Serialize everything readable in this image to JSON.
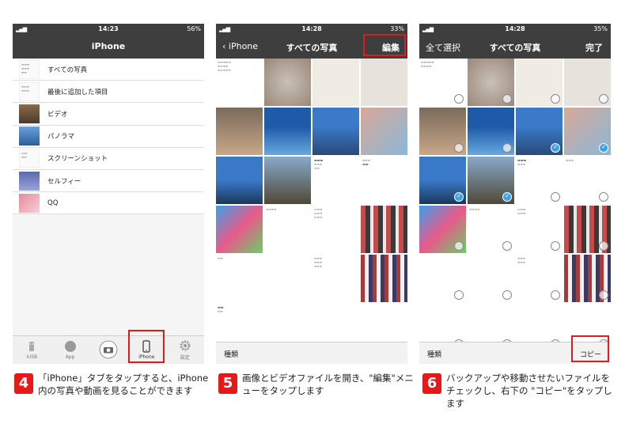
{
  "panel1": {
    "status": {
      "time": "14:23",
      "battery": "56%"
    },
    "title": "iPhone",
    "rows": [
      "すべての写真",
      "最後に追加した項目",
      "ビデオ",
      "パノラマ",
      "スクリーンショット",
      "セルフィー",
      "QQ"
    ],
    "tabs": [
      {
        "label": "iUSB",
        "icon": "usb-icon"
      },
      {
        "label": "App",
        "icon": "app-icon"
      },
      {
        "label": "",
        "icon": "camera-icon"
      },
      {
        "label": "iPhone",
        "icon": "iphone-icon"
      },
      {
        "label": "設定",
        "icon": "gear-icon"
      }
    ]
  },
  "panel2": {
    "status": {
      "time": "14:28",
      "battery": "33%"
    },
    "back": "iPhone",
    "title": "すべての写真",
    "edit": "編集",
    "bottom_left": "種類"
  },
  "panel3": {
    "status": {
      "time": "14:28",
      "battery": "35%"
    },
    "select_all": "全て選択",
    "title": "すべての写真",
    "done": "完了",
    "bottom_left": "種類",
    "copy": "コピー"
  },
  "steps": [
    {
      "num": "4",
      "text": "「iPhone」タブをタップすると、iPhone内の写真や動画を見ることができます"
    },
    {
      "num": "5",
      "text": "画像とビデオファイルを開き、\"編集\"メニューをタップします"
    },
    {
      "num": "6",
      "text": "バックアップや移動させたいファイルをチェックし、右下の \"コピー\"をタップします"
    }
  ],
  "colors": {
    "accent": "#e21a1a",
    "navbar": "#3e3e3e",
    "check": "#3fa0e8"
  }
}
